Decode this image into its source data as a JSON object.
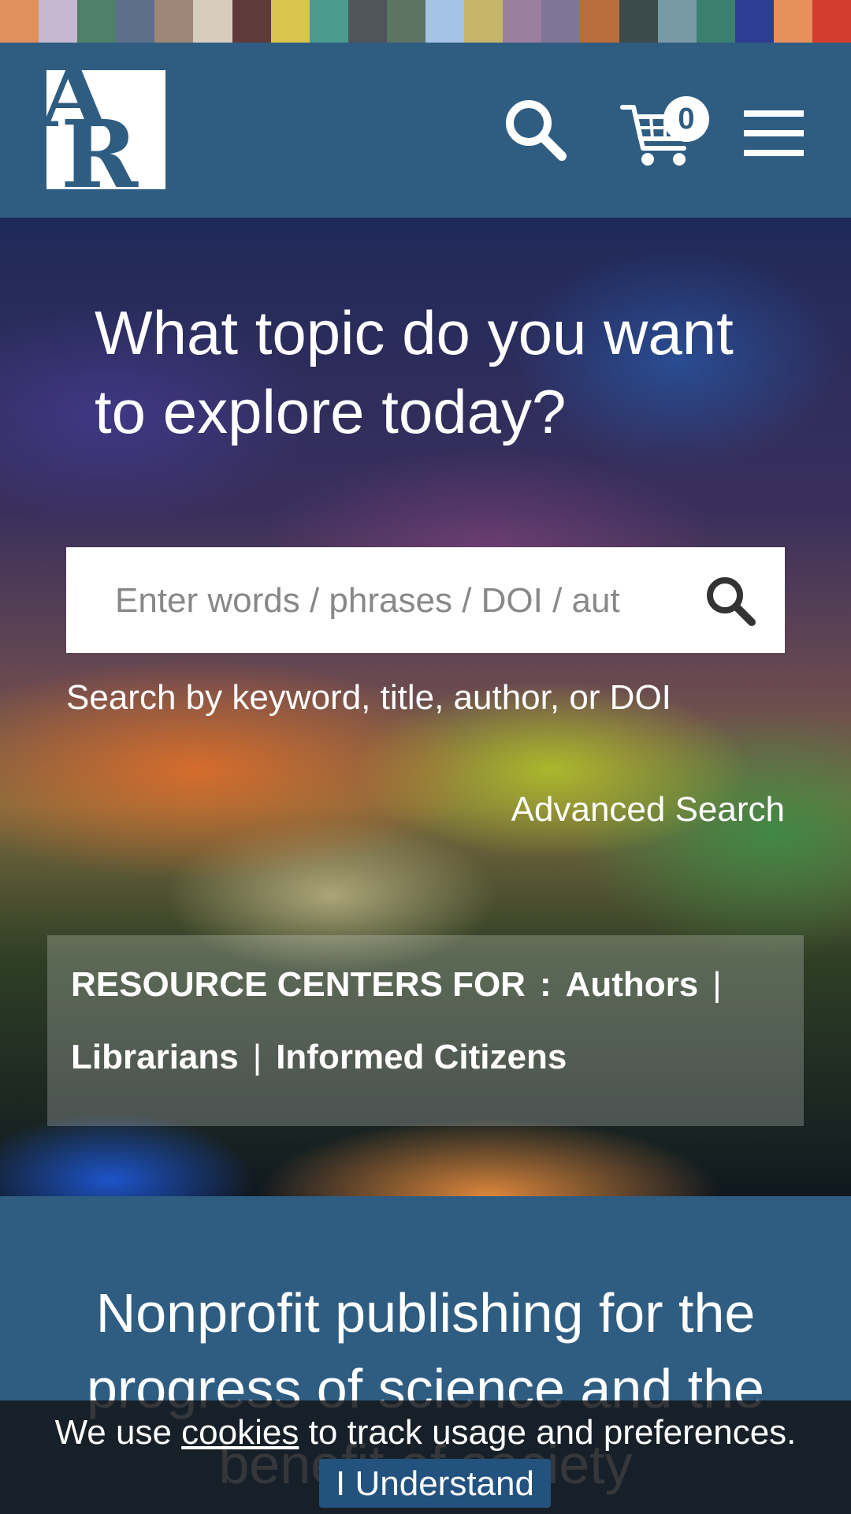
{
  "stripe_colors": [
    "#e0905c",
    "#c6b8d1",
    "#4f8068",
    "#5d6f8b",
    "#9e8776",
    "#d6cdbf",
    "#5e3a3a",
    "#d8c64c",
    "#4b9a8e",
    "#4f555a",
    "#5d7462",
    "#a5c3e4",
    "#c4b56b",
    "#9b7f9f",
    "#7f7596",
    "#ba6d3a",
    "#3b4a4a",
    "#789aa6",
    "#3b7f6f",
    "#2e3d92",
    "#e6905d",
    "#d33c2f"
  ],
  "header": {
    "logo_letters": [
      "A",
      "R"
    ],
    "cart_count": "0",
    "icons": {
      "search": "search-icon",
      "cart": "cart-icon",
      "menu": "hamburger-menu-icon"
    }
  },
  "hero": {
    "title": "What topic do you want to explore today?",
    "search_placeholder": "Enter words / phrases / DOI / aut",
    "search_hint": "Search by keyword, title, author, or DOI",
    "advanced_search": "Advanced Search",
    "resource_centers": {
      "label": "RESOURCE CENTERS FOR",
      "colon": ":",
      "separator": "|",
      "links": [
        "Authors",
        "Librarians",
        "Informed Citizens"
      ]
    }
  },
  "mission": {
    "title": "Nonprofit publishing for the progress of science and the benefit of society"
  },
  "cookie_banner": {
    "text_before": "We use",
    "link": "cookies",
    "text_after": "to track usage and preferences.",
    "button": "I Understand"
  },
  "colors": {
    "brand_blue": "#2f5d82",
    "white": "#ffffff",
    "cookie_bg": "#14161a",
    "cookie_button": "#23527e"
  }
}
